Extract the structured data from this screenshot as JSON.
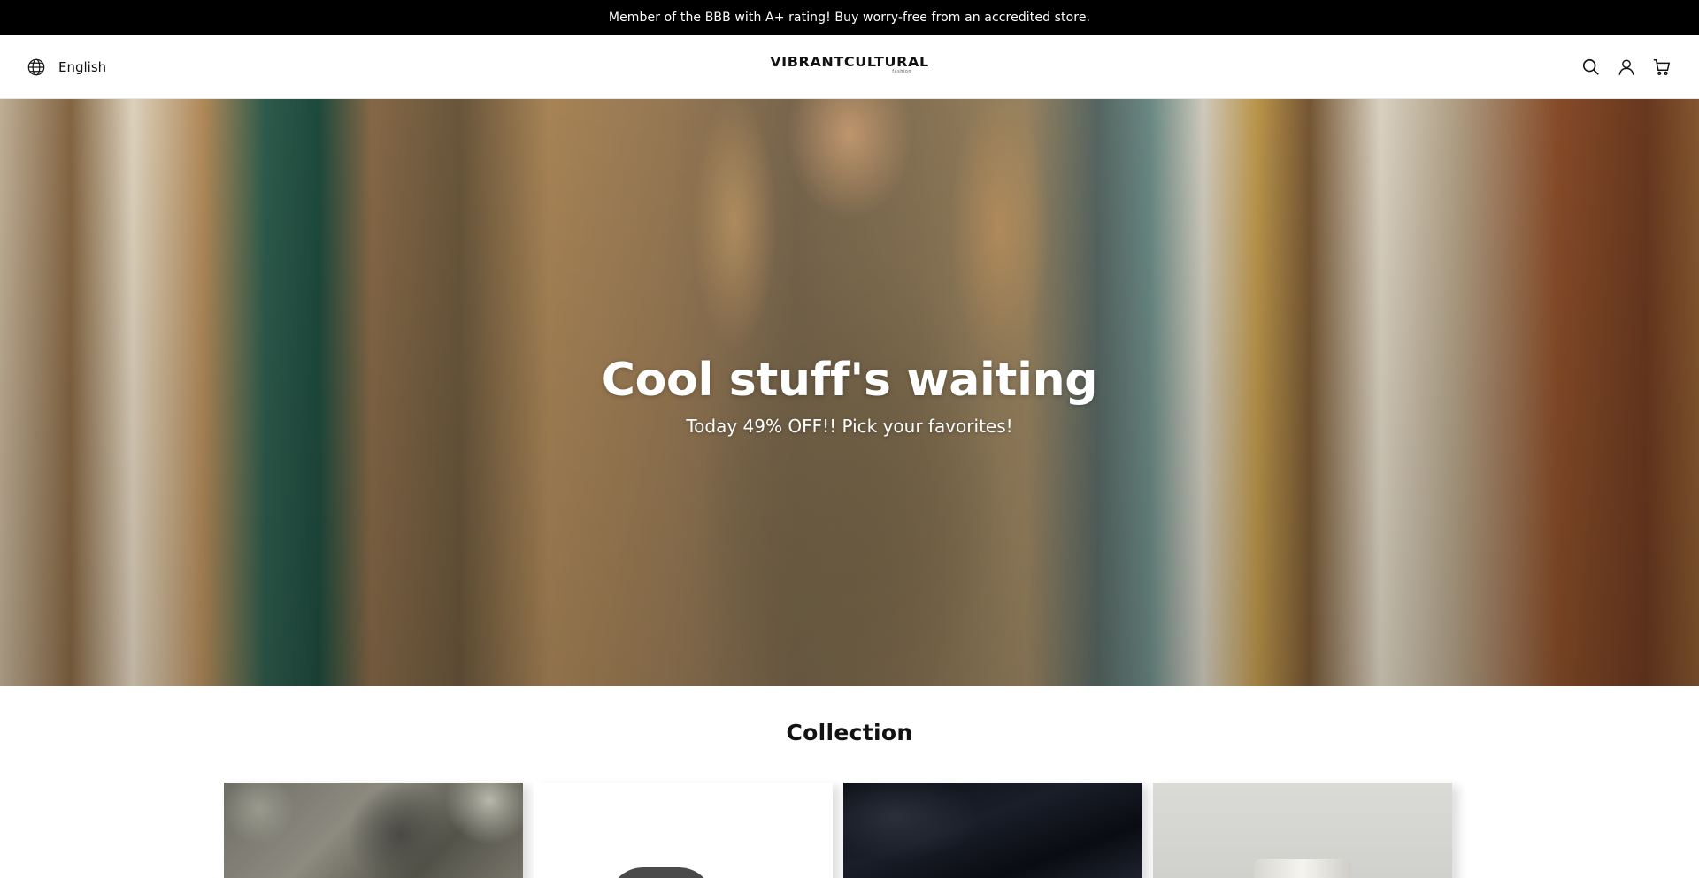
{
  "announcement": {
    "text": "Member of the BBB with A+ rating! Buy worry-free from an accredited store."
  },
  "header": {
    "language_label": "English",
    "logo_text": "VIBRANTCULTURAL",
    "logo_subtext": "fashion",
    "icons": [
      "globe-icon",
      "search-icon",
      "account-icon",
      "cart-icon"
    ]
  },
  "hero": {
    "title": "Cool stuff's waiting",
    "subtitle": "Today 49% OFF!! Pick your favorites!"
  },
  "collection": {
    "title": "Collection",
    "cards": [
      {
        "image": "stone-texture"
      },
      {
        "image": "shoe"
      },
      {
        "image": "dark-fabric"
      },
      {
        "image": "lamp"
      }
    ]
  },
  "colors": {
    "announcement_bg": "#000000",
    "announcement_text": "#ffffff",
    "text": "#121212"
  }
}
